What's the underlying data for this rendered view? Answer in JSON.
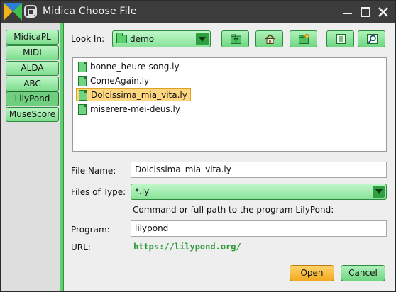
{
  "window": {
    "title": "Midica Choose File"
  },
  "tabs": [
    {
      "label": "MidicaPL",
      "active": false
    },
    {
      "label": "MIDI",
      "active": false
    },
    {
      "label": "ALDA",
      "active": false
    },
    {
      "label": "ABC",
      "active": false
    },
    {
      "label": "LilyPond",
      "active": true
    },
    {
      "label": "MuseScore",
      "active": false
    }
  ],
  "lookin": {
    "label": "Look In:",
    "value": "demo"
  },
  "toolbar": [
    {
      "icon": "up-folder-icon"
    },
    {
      "icon": "home-icon"
    },
    {
      "icon": "new-folder-icon"
    },
    {
      "icon": "list-view-icon"
    },
    {
      "icon": "details-view-icon"
    }
  ],
  "files": [
    {
      "name": "bonne_heure-song.ly",
      "selected": false
    },
    {
      "name": "ComeAgain.ly",
      "selected": false
    },
    {
      "name": "Dolcissima_mia_vita.ly",
      "selected": true
    },
    {
      "name": "miserere-mei-deus.ly",
      "selected": false
    }
  ],
  "form": {
    "filename_label": "File Name:",
    "filename_value": "Dolcissima_mia_vita.ly",
    "filetype_label": "Files of Type:",
    "filetype_value": "*.ly",
    "command_hint": "Command or full path to the program LilyPond:",
    "program_label": "Program:",
    "program_value": "lilypond",
    "url_label": "URL:",
    "url_value": "https://lilypond.org/"
  },
  "buttons": {
    "open": "Open",
    "cancel": "Cancel"
  },
  "colors": {
    "accent_green": "#6fd581",
    "selection": "#ffd780",
    "open_button": "#f2a91e",
    "titlebar": "#3c3c3c"
  }
}
